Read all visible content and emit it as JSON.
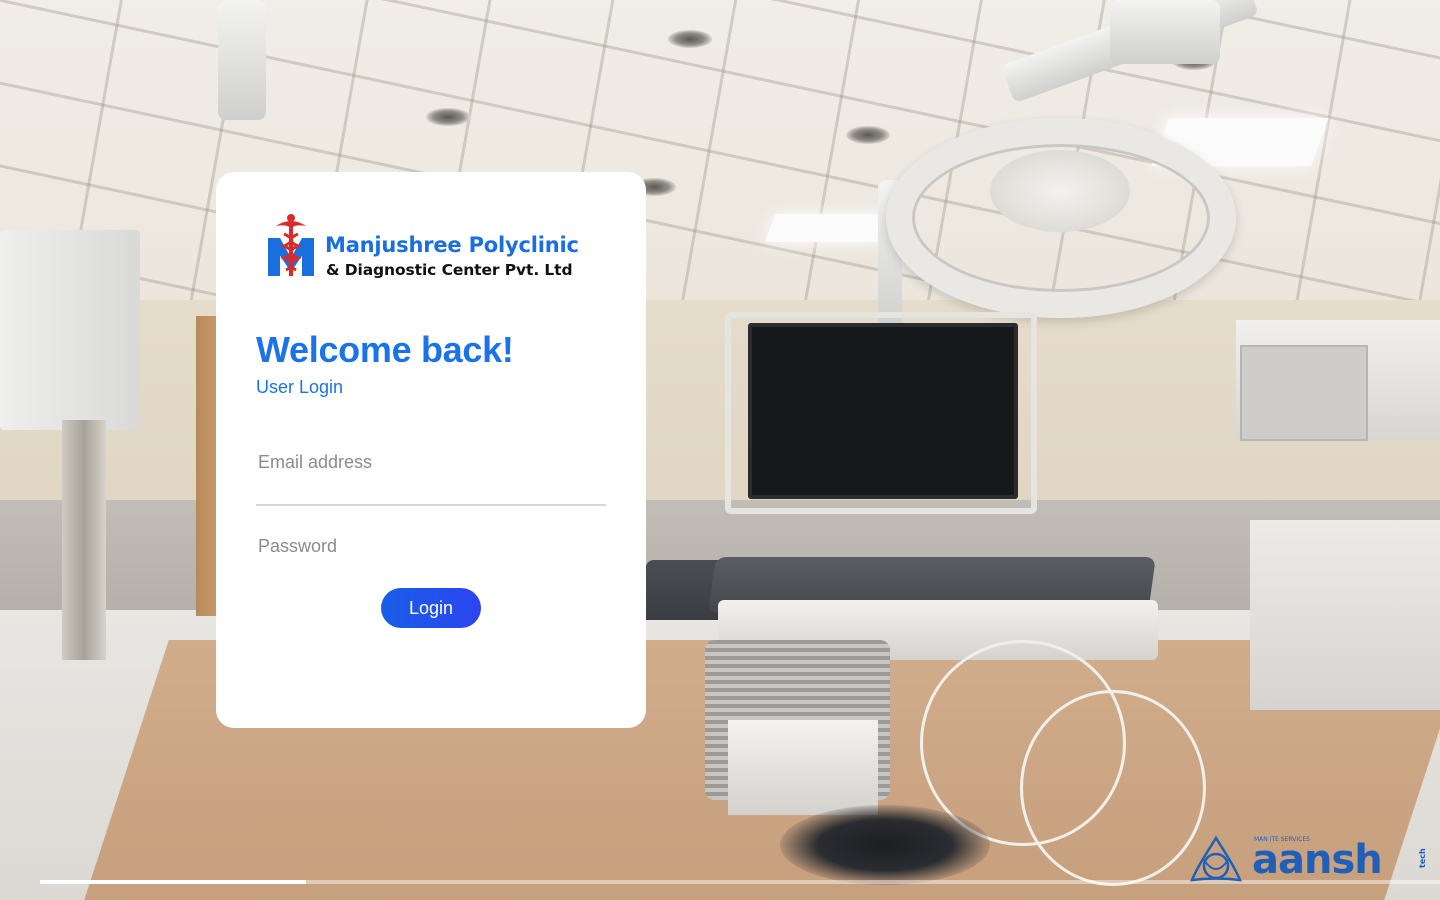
{
  "logo": {
    "line1": "Manjushree Polyclinic",
    "line2": "& Diagnostic Center Pvt. Ltd",
    "icon": "caduceus-icon",
    "accent_color": "#1a6fe0"
  },
  "login": {
    "heading": "Welcome back!",
    "subtitle": "User Login",
    "email_placeholder": "Email address",
    "password_placeholder": "Password",
    "button_label": "Login",
    "button_color": "#1f52ea"
  },
  "background": {
    "scene": "operating room background photo"
  },
  "progress": {
    "fraction": 0.19
  },
  "brand": {
    "name": "aansh",
    "tag": "MAN ITE SERVICES",
    "suffix": "tech",
    "icon": "triquetra-logo-icon",
    "color": "#1f5fb8"
  }
}
